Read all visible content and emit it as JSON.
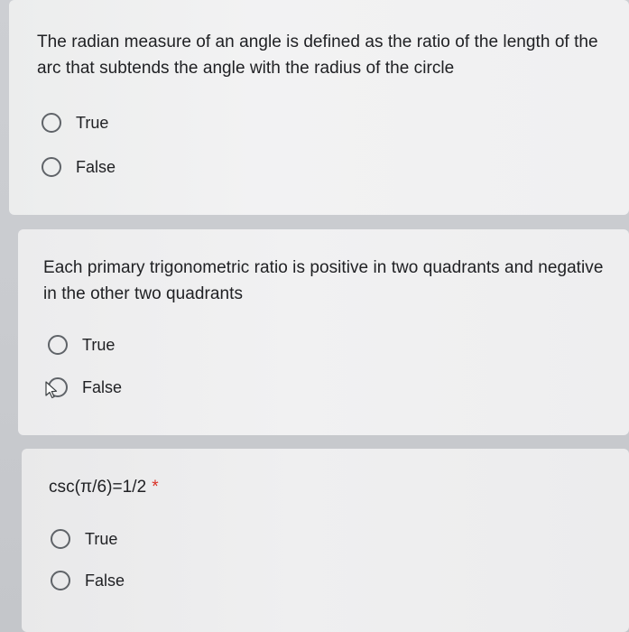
{
  "questions": [
    {
      "text": "The radian measure of an angle is defined as the ratio of the length of the arc that subtends the angle with the radius of the circle",
      "required_mark": "",
      "options": [
        {
          "label": "True",
          "selected": false
        },
        {
          "label": "False",
          "selected": false
        }
      ]
    },
    {
      "text": "Each primary trigonometric ratio is positive in two quadrants and negative in the other two quadrants",
      "required_mark": "",
      "options": [
        {
          "label": "True",
          "selected": false
        },
        {
          "label": "False",
          "selected": false
        }
      ]
    },
    {
      "text": "csc(π/6)=1/2",
      "required_mark": "*",
      "options": [
        {
          "label": "True",
          "selected": false
        },
        {
          "label": "False",
          "selected": false
        }
      ]
    }
  ],
  "colors": {
    "required_mark": "#d93025",
    "radio_border": "#5f6368",
    "text": "#202124"
  },
  "cursor_icon": "mouse-pointer-icon"
}
